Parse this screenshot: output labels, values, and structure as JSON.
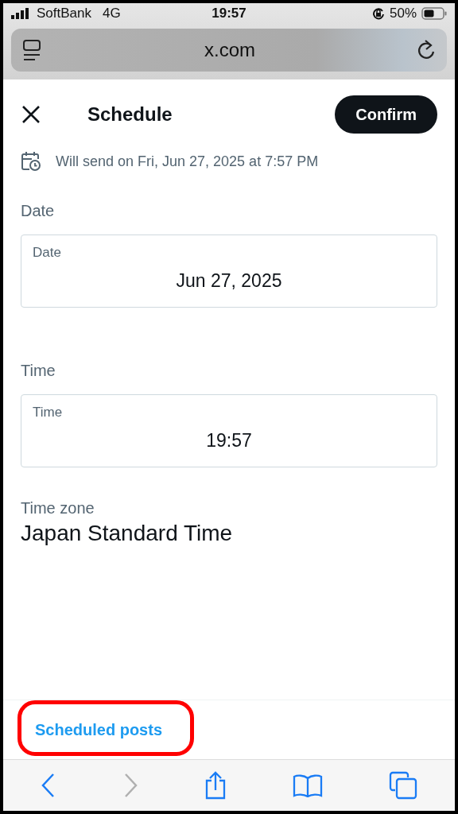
{
  "status_bar": {
    "carrier": "SoftBank",
    "network": "4G",
    "time": "19:57",
    "battery": "50%"
  },
  "address_bar": {
    "url": "x.com"
  },
  "header": {
    "title": "Schedule",
    "confirm": "Confirm"
  },
  "info": "Will send on Fri, Jun 27, 2025 at 7:57 PM",
  "fields": [
    {
      "section": "Date",
      "label": "Date",
      "value": "Jun 27, 2025"
    },
    {
      "section": "Time",
      "label": "Time",
      "value": "19:57"
    }
  ],
  "time_zone": {
    "label": "Time zone",
    "value": "Japan Standard Time"
  },
  "scheduled_posts": {
    "label": "Scheduled posts",
    "highlighted": true
  },
  "toolbar": {
    "back_disabled": false,
    "forward_disabled": true
  }
}
